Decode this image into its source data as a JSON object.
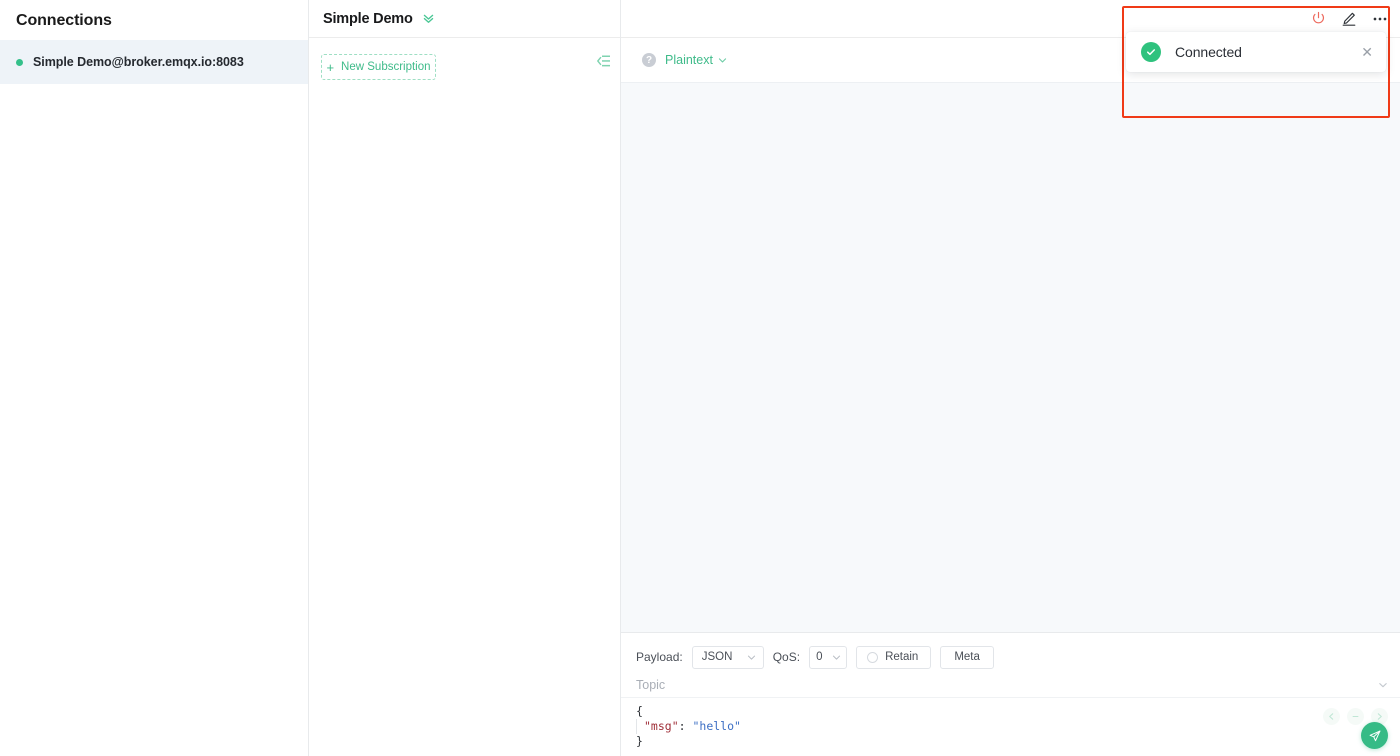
{
  "sidebar": {
    "title": "Connections",
    "connections": [
      {
        "label": "Simple Demo@broker.emqx.io:8083",
        "status": "connected",
        "status_color": "#34c08a"
      }
    ]
  },
  "center": {
    "title": "Simple Demo",
    "expand_icon": "double-chevron-down-icon",
    "new_subscription_label": "New Subscription",
    "new_subscription_plus": "+",
    "collapse_icon": "collapse-panel-icon"
  },
  "header_actions": {
    "disconnect_icon": "power-icon",
    "edit_icon": "pencil-edit-icon",
    "more_icon": "more-horizontal-icon",
    "power_color": "#ed6a5e"
  },
  "messages": {
    "help_icon": "question-circle-icon",
    "help_glyph": "?",
    "format_label": "Plaintext",
    "format_chevron": "chevron-down-icon",
    "accent_color": "#3fbb8a"
  },
  "publish": {
    "payload_label": "Payload:",
    "payload_value": "JSON",
    "qos_label": "QoS:",
    "qos_value": "0",
    "retain_label": "Retain",
    "retain_checked": false,
    "meta_label": "Meta",
    "topic_placeholder": "Topic",
    "topic_value": "",
    "topic_chevron": "chevron-down-icon",
    "editor_lines": [
      "{",
      "  \"msg\": \"hello\"",
      "}"
    ],
    "json_key": "\"msg\"",
    "json_colon": ": ",
    "json_value": "\"hello\"",
    "brace_open": "{",
    "brace_close": "}",
    "ctrl_prev_icon": "arrow-left-icon",
    "ctrl_minus_icon": "minus-icon",
    "ctrl_next_icon": "arrow-right-icon",
    "send_icon": "send-paper-plane-icon",
    "send_color": "#36bb86"
  },
  "toast": {
    "message": "Connected",
    "status_icon": "check-circle-icon",
    "close_icon": "close-x-icon",
    "close_glyph": "✕",
    "success_color": "#2fc27e"
  },
  "annotation": {
    "highlight_color": "#f03a17"
  }
}
